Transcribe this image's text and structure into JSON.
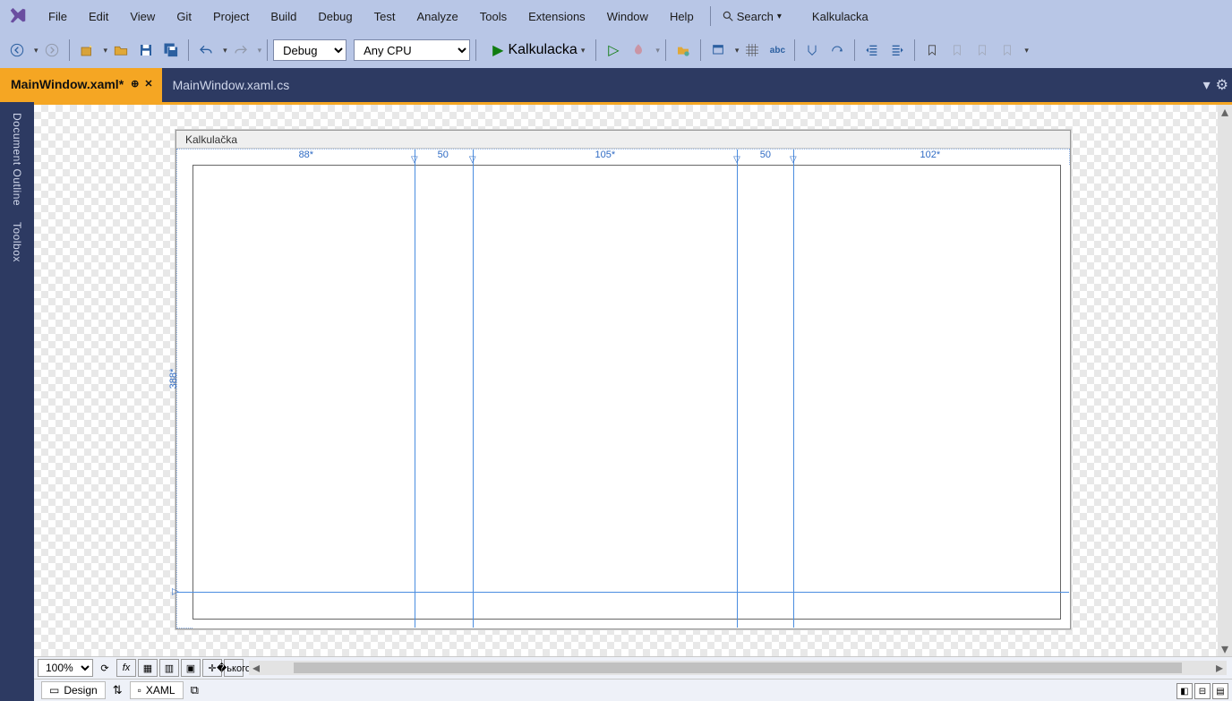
{
  "menu": {
    "file": "File",
    "edit": "Edit",
    "view": "View",
    "git": "Git",
    "project": "Project",
    "build": "Build",
    "debug": "Debug",
    "test": "Test",
    "analyze": "Analyze",
    "tools": "Tools",
    "extensions": "Extensions",
    "window": "Window",
    "help": "Help"
  },
  "search_label": "Search",
  "app_title": "Kalkulacka",
  "toolbar": {
    "config": "Debug",
    "platform": "Any CPU",
    "start_label": "Kalkulacka"
  },
  "tabs": {
    "active": "MainWindow.xaml*",
    "inactive": "MainWindow.xaml.cs"
  },
  "sidepanels": {
    "outline": "Document Outline",
    "toolbox": "Toolbox"
  },
  "designer": {
    "window_title": "Kalkulačka",
    "cols": [
      "88*",
      "50",
      "105*",
      "50",
      "102*"
    ],
    "rows": [
      "388*"
    ]
  },
  "zoom": "100%",
  "bottom_tabs": {
    "design": "Design",
    "xaml": "XAML"
  }
}
